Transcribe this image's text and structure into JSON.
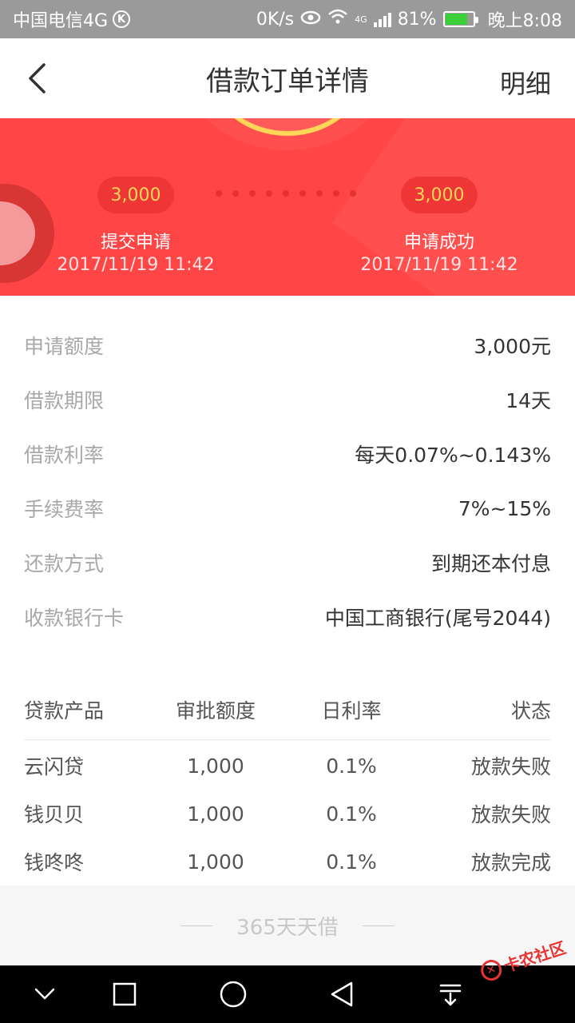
{
  "status_bar": {
    "carrier": "中国电信4G",
    "carrier_badge": "K",
    "net_speed": "0K/s",
    "network_type": "4G",
    "battery_percent": "81%",
    "battery_level": 0.81,
    "time": "晚上8:08",
    "icons": [
      "eye-icon",
      "wifi-icon",
      "signal-icon",
      "battery-icon"
    ]
  },
  "nav": {
    "title": "借款订单详情",
    "right_action": "明细",
    "back_icon": "chevron-left-icon"
  },
  "progress": {
    "start": {
      "amount": "3,000",
      "label": "提交申请",
      "time": "2017/11/19 11:42"
    },
    "end": {
      "amount": "3,000",
      "label": "申请成功",
      "time": "2017/11/19 11:42"
    }
  },
  "info": [
    {
      "label": "申请额度",
      "value": "3,000元"
    },
    {
      "label": "借款期限",
      "value": "14天"
    },
    {
      "label": "借款利率",
      "value": "每天0.07%~0.143%"
    },
    {
      "label": "手续费率",
      "value": "7%~15%"
    },
    {
      "label": "还款方式",
      "value": "到期还本付息"
    },
    {
      "label": "收款银行卡",
      "value": "中国工商银行(尾号2044)"
    }
  ],
  "table": {
    "headers": [
      "贷款产品",
      "审批额度",
      "日利率",
      "状态"
    ],
    "rows": [
      [
        "云闪贷",
        "1,000",
        "0.1%",
        "放款失败"
      ],
      [
        "钱贝贝",
        "1,000",
        "0.1%",
        "放款失败"
      ],
      [
        "钱咚咚",
        "1,000",
        "0.1%",
        "放款完成"
      ]
    ]
  },
  "footer": {
    "text": "365天天借"
  },
  "watermark": {
    "text": "卡农社区"
  },
  "colors": {
    "banner_red": "#ff4545",
    "pill_text": "#ffd658",
    "label_gray": "#a8a8a8",
    "status_bar": "#9a9a9a"
  }
}
